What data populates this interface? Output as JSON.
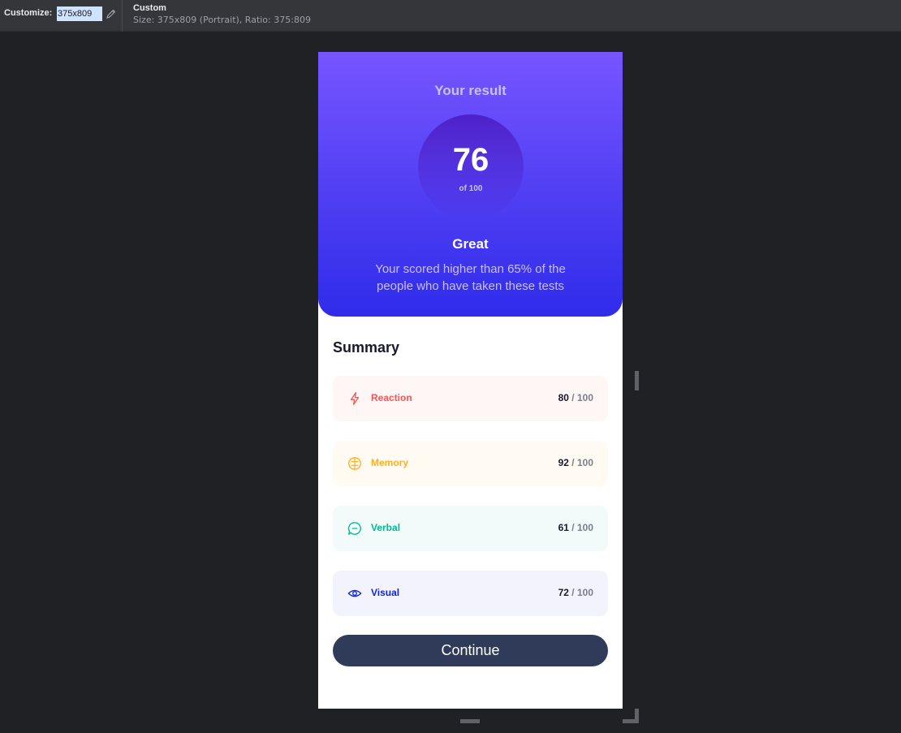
{
  "toolbar": {
    "customize_label": "Customize:",
    "size_value": "375x809",
    "device_title": "Custom",
    "device_info": "Size: 375x809 (Portrait), Ratio: 375:809"
  },
  "result": {
    "title": "Your result",
    "score": "76",
    "out_of": "of 100",
    "grade": "Great",
    "description": "Your scored higher than 65% of the people who have taken these tests"
  },
  "summary": {
    "title": "Summary",
    "items": [
      {
        "label": "Reaction",
        "score": "80",
        "max": "/ 100",
        "color": "#f55757",
        "icon": "lightning-icon"
      },
      {
        "label": "Memory",
        "score": "92",
        "max": "/ 100",
        "color": "#ffb01f",
        "icon": "brain-icon"
      },
      {
        "label": "Verbal",
        "score": "61",
        "max": "/ 100",
        "color": "#00bb8f",
        "icon": "chat-bubble-icon"
      },
      {
        "label": "Visual",
        "score": "72",
        "max": "/ 100",
        "color": "#1125d6",
        "icon": "eye-icon"
      }
    ],
    "continue_label": "Continue"
  },
  "colors": {
    "gradient_top": "#7755ff",
    "gradient_bottom": "#2f2cea",
    "button": "#303b5a",
    "page_bg": "#202124"
  }
}
